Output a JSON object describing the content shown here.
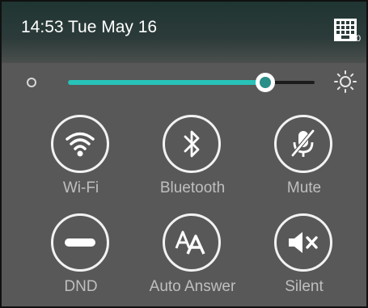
{
  "status_bar": {
    "time_date": "14:53 Tue May 16",
    "keyboard_icon": "keyboard-grid-icon",
    "keyboard_badge": "0"
  },
  "brightness": {
    "level_fraction": 0.8,
    "low_icon": "brightness-low-icon",
    "high_icon": "brightness-high-icon",
    "accent_color": "#28c2b8"
  },
  "tiles": [
    {
      "label": "Wi-Fi",
      "icon": "wifi-icon"
    },
    {
      "label": "Bluetooth",
      "icon": "bluetooth-icon"
    },
    {
      "label": "Mute",
      "icon": "mic-muted-icon"
    },
    {
      "label": "DND",
      "icon": "do-not-disturb-icon"
    },
    {
      "label": "Auto Answer",
      "icon": "auto-answer-icon"
    },
    {
      "label": "Silent",
      "icon": "speaker-muted-icon"
    }
  ]
}
